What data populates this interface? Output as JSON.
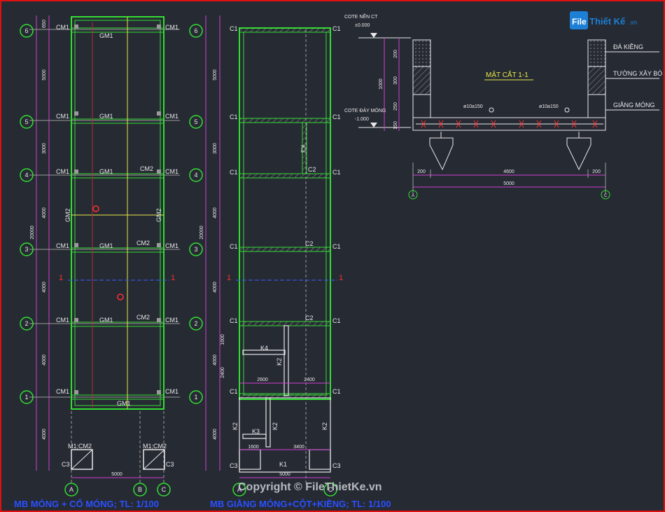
{
  "logo": {
    "text_a": "File",
    "text_b": "Thiết Kế",
    "text_c": ".vn"
  },
  "copyright": "Copyright © FileThietKe.vn",
  "plan1": {
    "title": "MB MÓNG + CỔ MÓNG; TL: 1/100",
    "axes_left": [
      "6",
      "5",
      "4",
      "3",
      "2",
      "1"
    ],
    "axes_bottom": [
      "A",
      "B",
      "C"
    ],
    "dims_left": [
      "650",
      "5000",
      "3000",
      "4000",
      "4000",
      "4000",
      "4000"
    ],
    "dim_total": "20000",
    "dim_bottom": "5000",
    "labels": {
      "cm1": "CM1",
      "cm2": "CM2",
      "gm1": "GM1",
      "gm2": "GM2",
      "m1cm2": "M1;CM2",
      "c3": "C3",
      "section": "1"
    }
  },
  "plan2": {
    "title": "MB GIẰNG MÓNG+CỘT+KIỀNG; TL: 1/100",
    "dims_left": [
      "5000",
      "3000",
      "4000",
      "4000",
      "4000",
      "1600",
      "2400",
      "4000"
    ],
    "dim_total": "20000",
    "dim_bottom": "5000",
    "dims_inner": [
      "2600",
      "2400",
      "1600",
      "3400"
    ],
    "labels": {
      "c1": "C1",
      "c2": "C2",
      "c3": "C3",
      "k1": "K1",
      "k2": "K2",
      "k3": "K3",
      "k4": "K4",
      "section": "1"
    }
  },
  "section": {
    "title": "MẶT CẮT 1-1",
    "cote_top": "COTE NỀN CT",
    "cote_top_val": "±0.000",
    "cote_bottom": "COTE ĐÁY MÓNG",
    "cote_bottom_val": "-1.000",
    "dims_vertical": [
      "200",
      "300",
      "250",
      "150"
    ],
    "dim_vertical_total": "1000",
    "legend": [
      "ĐÁ KIỀNG",
      "TƯỜNG XÂY BÓ",
      "GIẰNG MÓNG"
    ],
    "rebar": "ø10a150",
    "dims_bottom": [
      "200",
      "4600",
      "200"
    ],
    "dim_bottom_total": "5000",
    "axes": [
      "A",
      "C"
    ]
  },
  "colors": {
    "green": "#33dd33",
    "white": "#e8e8e8",
    "yellow": "#e8e84a",
    "cyan": "#3aa0ff",
    "red": "#ff3030",
    "magenta": "#d040d0",
    "gray": "#9a9a9a",
    "blue_title": "#2a50ff"
  }
}
